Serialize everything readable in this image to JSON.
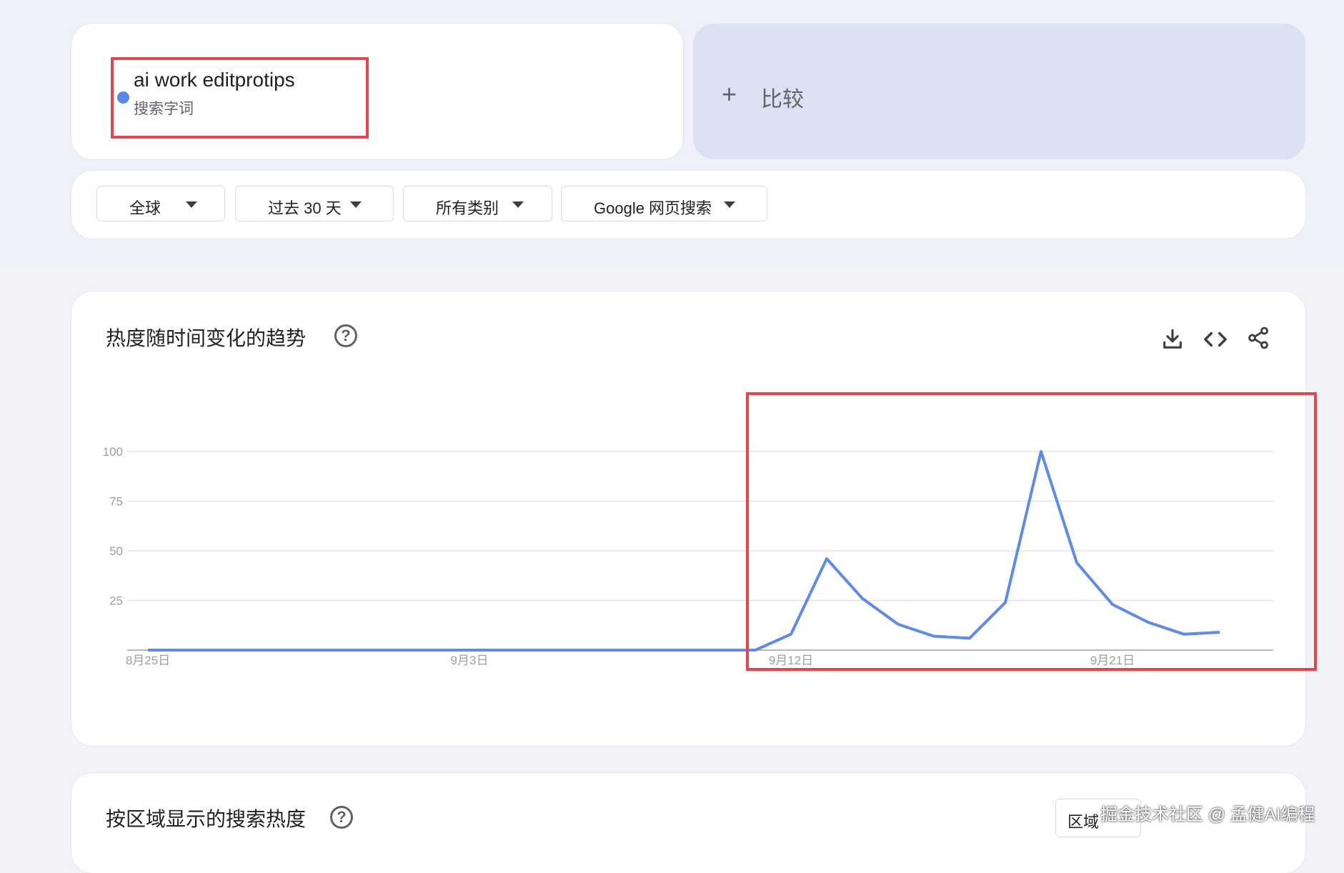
{
  "term": {
    "title": "ai work editprotips",
    "subtitle": "搜索字词",
    "color": "#5b87e8"
  },
  "compare": {
    "plus": "+",
    "label": "比较"
  },
  "filters": [
    {
      "label": "全球"
    },
    {
      "label": "过去 30 天"
    },
    {
      "label": "所有类别"
    },
    {
      "label": "Google 网页搜索"
    }
  ],
  "trend_section": {
    "title": "热度随时间变化的趋势",
    "help": "?",
    "tools": [
      "download-icon",
      "embed-code-icon",
      "share-icon"
    ]
  },
  "chart_data": {
    "type": "line",
    "x_tick_labels": [
      "8月25日",
      "9月3日",
      "9月12日",
      "9月21日"
    ],
    "y_ticks": [
      25,
      50,
      75,
      100
    ],
    "ylim": [
      0,
      100
    ],
    "grid": true,
    "highlight_box": true,
    "series": [
      {
        "color": "#5f8ae6",
        "values": [
          0,
          0,
          0,
          0,
          0,
          0,
          0,
          0,
          0,
          0,
          0,
          0,
          0,
          0,
          0,
          0,
          0,
          0,
          8,
          46,
          26,
          13,
          7,
          6,
          24,
          100,
          44,
          23,
          14,
          8,
          9
        ]
      }
    ]
  },
  "region_section": {
    "title": "按区域显示的搜索热度",
    "help": "?",
    "button_label": "区域"
  },
  "watermark": "掘金技术社区 @ 孟健AI编程",
  "colors": {
    "highlight": "#e2474f",
    "card": "#ffffff",
    "compare_bg": "#dbe1f2"
  }
}
